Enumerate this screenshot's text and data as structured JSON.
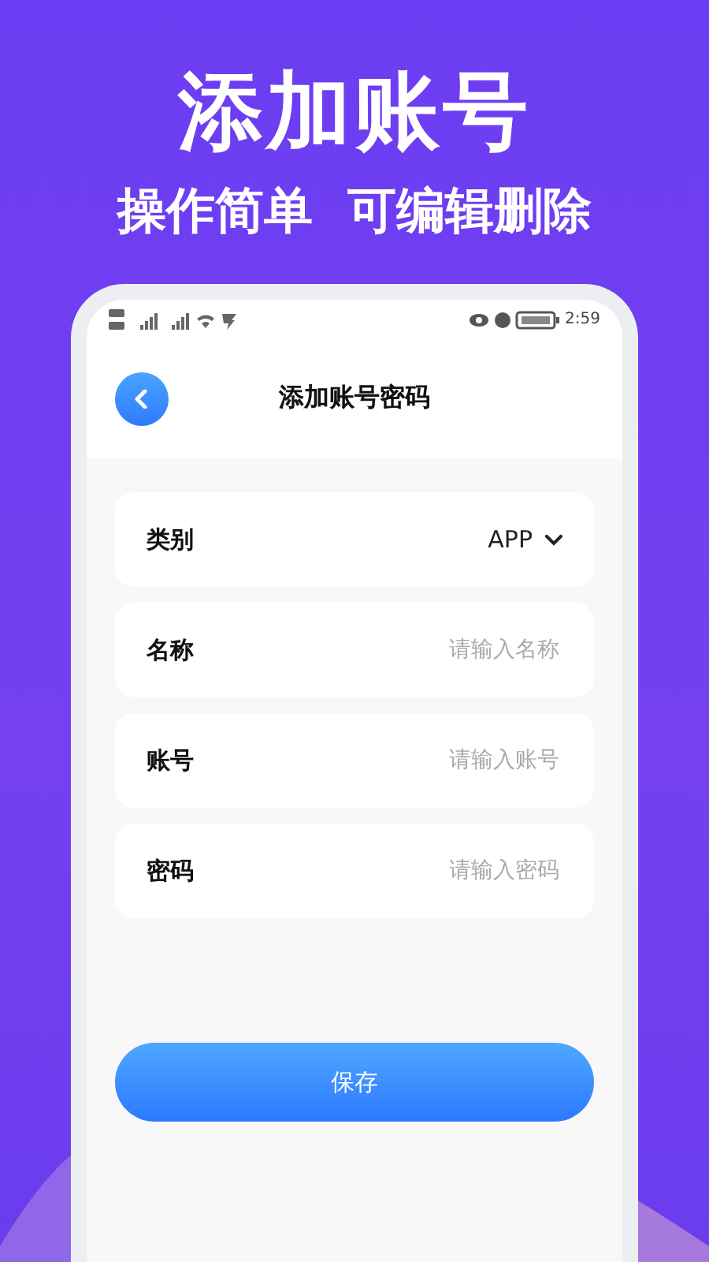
{
  "headline": "添加账号",
  "subheadline": "操作简单  可编辑删除",
  "status_bar": {
    "time": "2:59"
  },
  "header": {
    "title": "添加账号密码"
  },
  "fields": [
    {
      "kind": "select",
      "label": "类别",
      "value": "APP"
    },
    {
      "kind": "input",
      "label": "名称",
      "placeholder": "请输入名称"
    },
    {
      "kind": "input",
      "label": "账号",
      "placeholder": "请输入账号"
    },
    {
      "kind": "input",
      "label": "密码",
      "placeholder": "请输入密码"
    }
  ],
  "save_button": {
    "label": "保存"
  }
}
